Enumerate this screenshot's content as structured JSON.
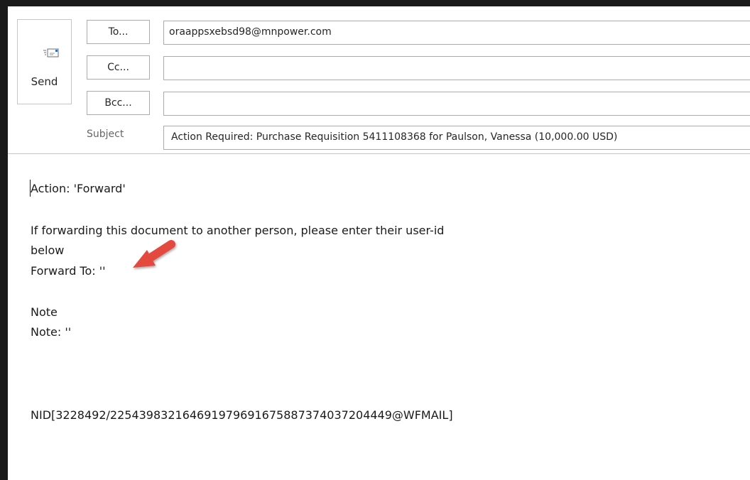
{
  "compose": {
    "send_label": "Send",
    "to_button": "To...",
    "cc_button": "Cc...",
    "bcc_button": "Bcc...",
    "to_value": "oraappsxebsd98@mnpower.com",
    "cc_value": "",
    "bcc_value": "",
    "subject_label": "Subject",
    "subject_value": "Action Required: Purchase Requisition 5411108368 for Paulson, Vanessa (10,000.00 USD)"
  },
  "body": {
    "line_action": "Action: 'Forward'",
    "line_forward_1": "If forwarding this document to another person, please enter their user-id",
    "line_forward_2": "below",
    "line_forward_3": "Forward To: ''",
    "line_note_1": "Note",
    "line_note_2": "Note: ''",
    "line_nid": "NID[3228492/225439832164691979691675887374037204449@WFMAIL]"
  },
  "icons": {
    "send": "send-envelope-icon",
    "annotation": "red-arrow-annotation-icon"
  },
  "colors": {
    "frame": "#1a1a1a",
    "border": "#ababab",
    "arrow": "#e4483f"
  }
}
